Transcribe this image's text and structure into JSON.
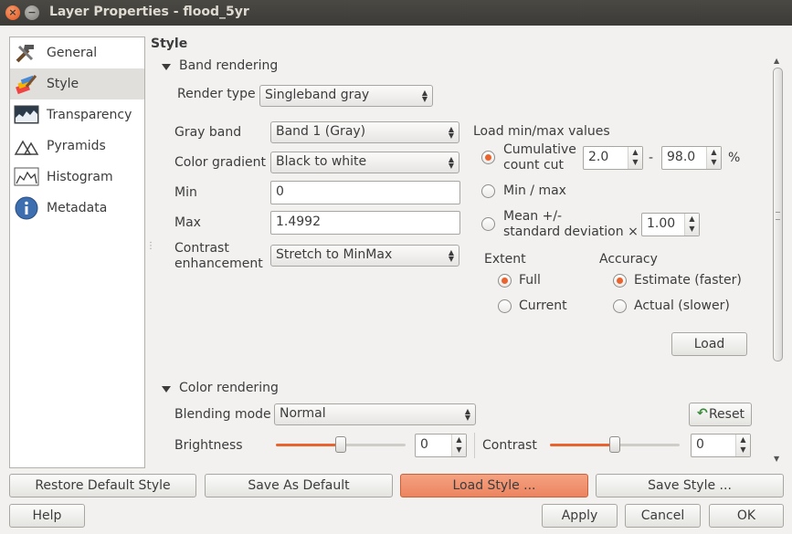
{
  "window": {
    "title": "Layer Properties - flood_5yr",
    "close_glyph": "×",
    "min_glyph": "−"
  },
  "sidebar": {
    "items": [
      {
        "label": "General",
        "icon": "tools-icon"
      },
      {
        "label": "Style",
        "icon": "paintbrush-icon"
      },
      {
        "label": "Transparency",
        "icon": "transparency-icon"
      },
      {
        "label": "Pyramids",
        "icon": "pyramids-icon"
      },
      {
        "label": "Histogram",
        "icon": "histogram-icon"
      },
      {
        "label": "Metadata",
        "icon": "info-icon"
      }
    ],
    "selected": "Style"
  },
  "style": {
    "heading": "Style",
    "band_rendering": {
      "label": "Band rendering",
      "render_type_label": "Render type",
      "render_type": "Singleband gray",
      "gray_band_label": "Gray band",
      "gray_band": "Band 1 (Gray)",
      "color_gradient_label": "Color gradient",
      "color_gradient": "Black to white",
      "min_label": "Min",
      "min": "0",
      "max_label": "Max",
      "max": "1.4992",
      "contrast_label_1": "Contrast",
      "contrast_label_2": "enhancement",
      "contrast": "Stretch to MinMax",
      "load_minmax_label": "Load min/max values",
      "cumulative_label_1": "Cumulative",
      "cumulative_label_2": "count cut",
      "cumulative_low": "2.0",
      "cumulative_dash": "-",
      "cumulative_high": "98.0",
      "percent": "%",
      "minmax_label": "Min / max",
      "mean_label_1": "Mean +/-",
      "mean_label_2": "standard deviation ×",
      "stddev": "1.00",
      "extent_label": "Extent",
      "extent_full": "Full",
      "extent_current": "Current",
      "accuracy_label": "Accuracy",
      "accuracy_estimate": "Estimate (faster)",
      "accuracy_actual": "Actual (slower)",
      "load_button": "Load"
    },
    "color_rendering": {
      "label": "Color rendering",
      "blending_label": "Blending mode",
      "blending": "Normal",
      "reset_button": "Reset",
      "brightness_label": "Brightness",
      "brightness": "0",
      "brightness_level": 0.5,
      "contrast_label": "Contrast",
      "contrast": "0",
      "contrast_level": 0.5
    }
  },
  "buttons": {
    "restore_default": "Restore Default Style",
    "save_default": "Save As Default",
    "load_style": "Load Style ...",
    "save_style": "Save Style ...",
    "help": "Help",
    "apply": "Apply",
    "cancel": "Cancel",
    "ok": "OK"
  },
  "colors": {
    "accent": "#e9632f",
    "hot_button": "#ec8460",
    "titlebar": "#3c3b37"
  }
}
